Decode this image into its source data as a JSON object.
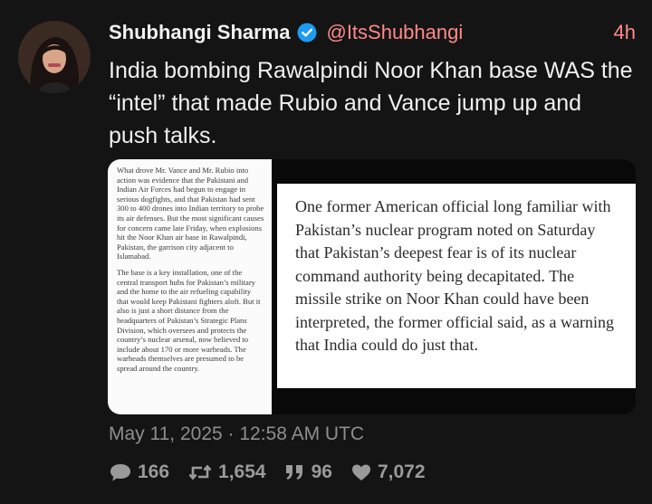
{
  "author": {
    "name": "Shubhangi Sharma",
    "handle": "@ItsShubhangi",
    "verified": true
  },
  "post": {
    "time_ago": "4h",
    "text": "India bombing Rawalpindi Noor Khan base WAS the “intel” that made Rubio and Vance jump up and push talks.",
    "timestamp": "May 11, 2025 · 12:58 AM UTC"
  },
  "media": {
    "article_paragraphs": [
      "What drove Mr. Vance and Mr. Rubio into action was evidence that the Pakistani and Indian Air Forces had begun to engage in serious dogfights, and that Pakistan had sent 300 to 400 drones into Indian territory to probe its air defenses. But the most significant causes for concern came late Friday, when explosions hit the Noor Khan air base in Rawalpindi, Pakistan, the garrison city adjacent to Islamabad.",
      "The base is a key installation, one of the central transport hubs for Pakistan’s military and the home to the air refueling capability that would keep Pakistani fighters aloft. But it also is just a short distance from the headquarters of Pakistan’s Strategic Plans Division, which oversees and protects the country’s nuclear arsenal, now believed to include about 170 or more warheads. The warheads themselves are presumed to be spread around the country."
    ],
    "quote": "One former American official long familiar with Pakistan’s nuclear program noted on Saturday that Pakistan’s deepest fear is of its nuclear command authority being decapitated. The missile strike on Noor Khan could have been interpreted, the former official said, as a warning that India could do just that."
  },
  "stats": {
    "replies": "166",
    "reposts": "1,654",
    "quotes": "96",
    "likes": "7,072"
  },
  "colors": {
    "background": "#141414",
    "accent": "#ff8a88",
    "verified": "#1d9bf0"
  },
  "icons": [
    "verified-badge-icon",
    "reply-icon",
    "repost-icon",
    "quote-icon",
    "like-icon"
  ]
}
